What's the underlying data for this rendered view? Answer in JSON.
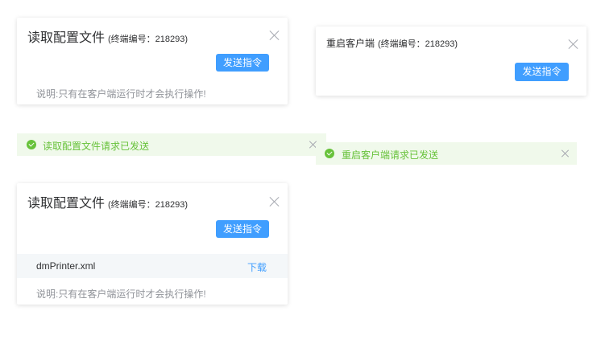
{
  "dialog_read_config_1": {
    "title": "读取配置文件",
    "terminal_label": "(终端编号：218293)",
    "send_button": "发送指令",
    "note": "说明:只有在客户端运行时才会执行操作!"
  },
  "dialog_restart": {
    "title": "重启客户端",
    "terminal_label": "(终端编号：218293)",
    "send_button": "发送指令"
  },
  "alert_read_config": {
    "message": "读取配置文件请求已发送"
  },
  "alert_restart": {
    "message": "重启客户端请求已发送"
  },
  "dialog_read_config_2": {
    "title": "读取配置文件",
    "terminal_label": "(终端编号：218293)",
    "send_button": "发送指令",
    "file": {
      "name": "dmPrinter.xml",
      "action": "下载"
    },
    "note": "说明:只有在客户端运行时才会执行操作!"
  },
  "colors": {
    "primary": "#409eff",
    "success": "#67c23a",
    "success_bg": "#f0f9eb"
  }
}
